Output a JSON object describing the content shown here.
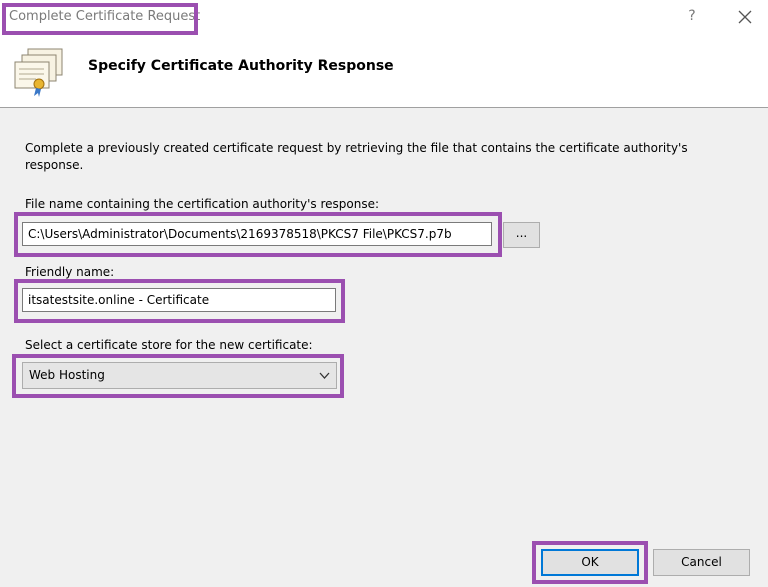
{
  "window": {
    "title": "Complete Certificate Request",
    "help_glyph": "?"
  },
  "header": {
    "title": "Specify Certificate Authority Response",
    "icon": "certificate-stack-icon"
  },
  "form": {
    "description": "Complete a previously created certificate request by retrieving the file that contains the certificate authority's response.",
    "file_label": "File name containing the certification authority's response:",
    "file_value": "C:\\Users\\Administrator\\Documents\\2169378518\\PKCS7 File\\PKCS7.p7b",
    "browse_label": "...",
    "friendly_label": "Friendly name:",
    "friendly_value": "itsatestsite.online - Certificate",
    "store_label": "Select a certificate store for the new certificate:",
    "store_value": "Web Hosting"
  },
  "buttons": {
    "ok": "OK",
    "cancel": "Cancel"
  },
  "colors": {
    "highlight": "#9b4fb0",
    "default_button_border": "#0078d7"
  }
}
